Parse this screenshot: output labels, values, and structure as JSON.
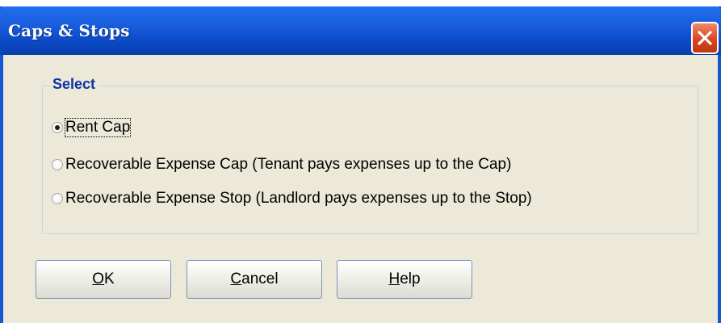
{
  "window": {
    "title": "Caps & Stops",
    "close_icon": "close-icon"
  },
  "group": {
    "label": "Select",
    "options": [
      {
        "label": "Rent Cap",
        "checked": true
      },
      {
        "label": "Recoverable Expense Cap (Tenant pays expenses up to the Cap)",
        "checked": false
      },
      {
        "label": "Recoverable Expense Stop (Landlord pays expenses up to the Stop)",
        "checked": false
      }
    ]
  },
  "buttons": {
    "ok": {
      "mnemonic": "O",
      "rest": "K"
    },
    "cancel": {
      "mnemonic": "C",
      "rest": "ancel"
    },
    "help": {
      "mnemonic": "H",
      "rest": "elp"
    }
  },
  "colors": {
    "title_bar": "#0a48c4",
    "close_button": "#d9461e",
    "dialog_bg": "#ece9d8",
    "group_label": "#0b33a8"
  }
}
